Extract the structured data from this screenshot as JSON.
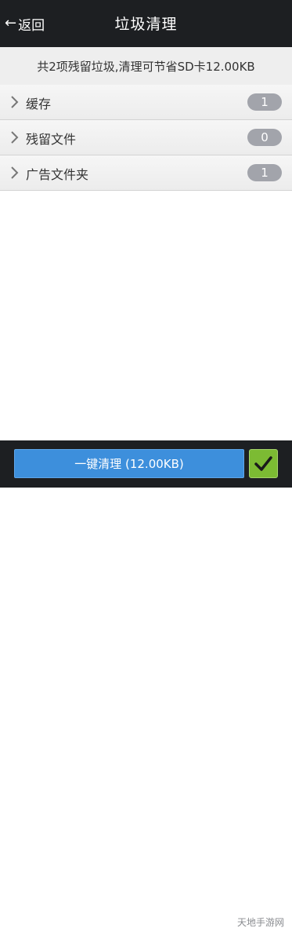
{
  "header": {
    "back_label": "返回",
    "back_icon": "arrow-left-icon",
    "title": "垃圾清理"
  },
  "summary": {
    "text": "共2项残留垃圾,清理可节省SD卡12.00KB"
  },
  "items": [
    {
      "label": "缓存",
      "count": "1",
      "icon": "chevron-right-icon"
    },
    {
      "label": "残留文件",
      "count": "0",
      "icon": "chevron-right-icon"
    },
    {
      "label": "广告文件夹",
      "count": "1",
      "icon": "chevron-right-icon"
    }
  ],
  "footer": {
    "clean_label": "一键清理 (12.00KB)",
    "confirm_icon": "checkmark-icon",
    "watermark": "天地手游网"
  },
  "colors": {
    "header_bg": "#1d1f22",
    "clean_button": "#3d8fdc",
    "confirm_button": "#7cbb33",
    "badge": "#a2a4ab"
  }
}
